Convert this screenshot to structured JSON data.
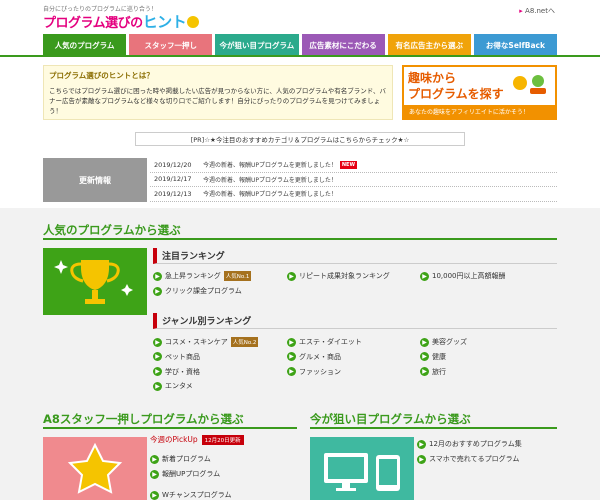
{
  "header": {
    "tagline": "自分にぴったりのプログラムに巡り合う！",
    "logo_text": "プログラム選びの",
    "logo_hint": "ヒント",
    "a8_link": "A8.netへ"
  },
  "nav": [
    {
      "label": "人気のプログラム",
      "color": "#3a9a1d"
    },
    {
      "label": "スタッフ一押し",
      "color": "#e8747c"
    },
    {
      "label": "今が狙い目プログラム",
      "color": "#2baa8c"
    },
    {
      "label": "広告素材にこだわる",
      "color": "#9b59b6"
    },
    {
      "label": "有名広告主から選ぶ",
      "color": "#f0a30a"
    },
    {
      "label": "お得なSelfBack",
      "color": "#3c9ad3"
    }
  ],
  "intro": {
    "title": "プログラム選びのヒントとは？",
    "body": "こちらではプログラム選びに困った時や掲載したい広告が見つからない方に、人気のプログラムや有名ブランド、バナー広告が素敵なプログラムなど様々な切り口でご紹介します！自分にぴったりのプログラムを見つけてみましょう！"
  },
  "banner": {
    "line1": "趣味から",
    "line2": "プログラムを探す",
    "sub": "あなたの趣味をアフィリエイトに活かそう！"
  },
  "pr_text": "[PR]☆★今注目のおすすめカテゴリ＆プログラムはこちらからチェック★☆",
  "updates": {
    "label": "更新情報",
    "items": [
      {
        "date": "2019/12/20",
        "text": "今週の新着、報酬UPプログラムを更新しました！",
        "new": "NEW"
      },
      {
        "date": "2019/12/17",
        "text": "今週の新着、報酬UPプログラムを更新しました！",
        "new": ""
      },
      {
        "date": "2019/12/13",
        "text": "今週の新着、報酬UPプログラムを更新しました！",
        "new": ""
      }
    ]
  },
  "popular": {
    "title": "人気のプログラムから選ぶ",
    "featured_heading": "注目ランキング",
    "featured": [
      {
        "label": "急上昇ランキング",
        "badge": "人気No.1"
      },
      {
        "label": "リピート成果対象ランキング",
        "badge": ""
      },
      {
        "label": "10,000円以上高額報酬",
        "badge": ""
      },
      {
        "label": "クリック課金プログラム",
        "badge": ""
      }
    ],
    "genre_heading": "ジャンル別ランキング",
    "genres": [
      {
        "label": "コスメ・スキンケア",
        "badge": "人気No.2"
      },
      {
        "label": "エステ・ダイエット",
        "badge": ""
      },
      {
        "label": "美容グッズ",
        "badge": ""
      },
      {
        "label": "ペット商品",
        "badge": ""
      },
      {
        "label": "グルメ・商品",
        "badge": ""
      },
      {
        "label": "健康",
        "badge": ""
      },
      {
        "label": "学び・資格",
        "badge": ""
      },
      {
        "label": "ファッション",
        "badge": ""
      },
      {
        "label": "旅行",
        "badge": ""
      },
      {
        "label": "エンタメ",
        "badge": ""
      }
    ]
  },
  "staff": {
    "title": "A8スタッフ一押しプログラムから選ぶ",
    "pickup_label": "今週のPickUp",
    "pickup_date": "12月20日更新",
    "items": [
      "新着プログラム",
      "報酬UPプログラム",
      "Wチャンスプログラム"
    ]
  },
  "target": {
    "title": "今が狙い目プログラムから選ぶ",
    "items": [
      "12月のおすすめプログラム集",
      "スマホで売れてるプログラム"
    ]
  }
}
